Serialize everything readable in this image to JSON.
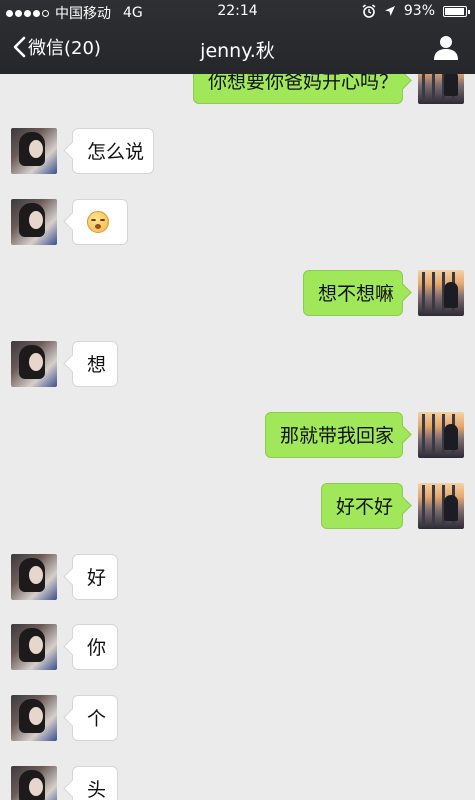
{
  "status_bar": {
    "carrier": "中国移动",
    "network": "4G",
    "time": "22:14",
    "battery": "93%",
    "battery_level": 0.93
  },
  "nav": {
    "back_label": "微信(20)",
    "title": "jenny.秋"
  },
  "messages": [
    {
      "side": "me",
      "text": "你想要你爸妈开心吗？"
    },
    {
      "side": "her",
      "text": "怎么说"
    },
    {
      "side": "her",
      "text": "",
      "emoji": "kiss-face-icon"
    },
    {
      "side": "me",
      "text": "想不想嘛"
    },
    {
      "side": "her",
      "text": "想"
    },
    {
      "side": "me",
      "text": "那就带我回家"
    },
    {
      "side": "me",
      "text": "好不好"
    },
    {
      "side": "her",
      "text": "好"
    },
    {
      "side": "her",
      "text": "你"
    },
    {
      "side": "her",
      "text": "个"
    },
    {
      "side": "her",
      "text": "头"
    }
  ],
  "colors": {
    "header_bg": "#2d2f33",
    "chat_bg": "#ebebeb",
    "my_bubble": "#a0e75a",
    "her_bubble": "#ffffff"
  }
}
